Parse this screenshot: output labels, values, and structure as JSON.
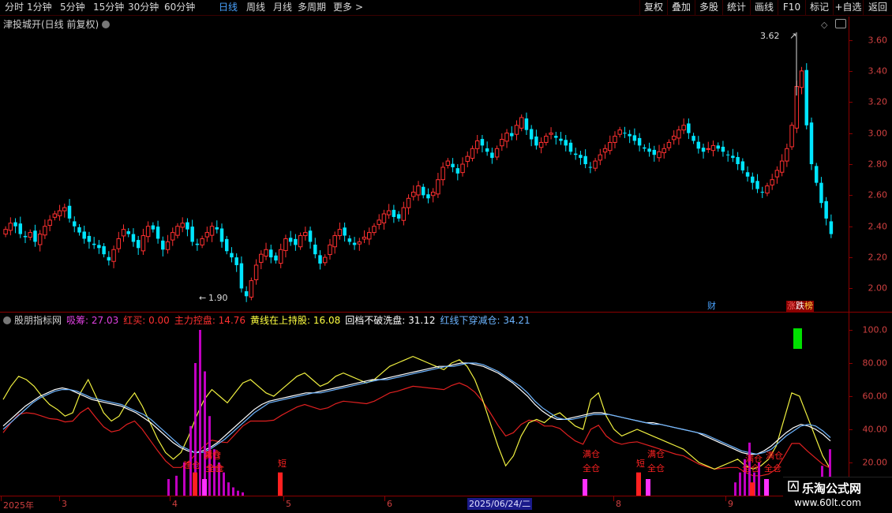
{
  "toolbar": {
    "periods": [
      "分时",
      "1分钟",
      "5分钟",
      "15分钟",
      "30分钟",
      "60分钟",
      "日线",
      "周线",
      "月线",
      "多周期",
      "更多"
    ],
    "active_period": "日线",
    "more_arrow": ">",
    "right_buttons": [
      "复权",
      "叠加",
      "多股",
      "统计",
      "画线",
      "F10",
      "标记",
      "+自选",
      "返回"
    ]
  },
  "main": {
    "title": "津投城开(日线 前复权)",
    "high_label": "3.62",
    "low_label": "1.90",
    "cai_badge": "财",
    "zdb_badge": [
      "涨",
      "跌",
      "榜"
    ],
    "y_ticks": [
      "3.60",
      "3.40",
      "3.20",
      "3.00",
      "2.80",
      "2.60",
      "2.40",
      "2.20",
      "2.00"
    ]
  },
  "indicator": {
    "name": "股朋指标网",
    "legend": [
      {
        "label": "吸筹: 27.03",
        "color": "#e040e0"
      },
      {
        "label": "红买: 0.00",
        "color": "#ff3030"
      },
      {
        "label": "主力控盘: 14.76",
        "color": "#ff3030"
      },
      {
        "label": "黄线在上持股: 16.08",
        "color": "#ffff40"
      },
      {
        "label": "回档不破洗盘: 31.12",
        "color": "#ffffff"
      },
      {
        "label": "红线下穿减仓: 34.21",
        "color": "#6cb4ff"
      }
    ],
    "y_ticks": [
      "100.0",
      "80.00",
      "60.00",
      "40.00",
      "20.00"
    ],
    "signals": [
      "建仓",
      "满仓",
      "全仓",
      "减仓",
      "全仓",
      "短",
      "满仓",
      "全仓",
      "短",
      "满仓",
      "全仓",
      "满仓",
      "全仓",
      "满仓",
      "全仓"
    ]
  },
  "date_axis": {
    "labels": [
      "2025年",
      "3",
      "4",
      "5",
      "6",
      "8",
      "9"
    ],
    "selected": "2025/06/24/二"
  },
  "watermark": {
    "name": "乐淘公式网",
    "url": "www.60lt.com"
  },
  "colors": {
    "up": "#ff3030",
    "down": "#00e5ff",
    "axis": "#8b0000"
  },
  "chart_data": {
    "type": "candlestick",
    "ylim": [
      1.85,
      3.75
    ],
    "closes": [
      2.38,
      2.42,
      2.4,
      2.35,
      2.33,
      2.36,
      2.3,
      2.35,
      2.4,
      2.44,
      2.48,
      2.5,
      2.52,
      2.45,
      2.4,
      2.36,
      2.32,
      2.3,
      2.28,
      2.26,
      2.22,
      2.18,
      2.25,
      2.32,
      2.38,
      2.35,
      2.3,
      2.26,
      2.34,
      2.4,
      2.38,
      2.32,
      2.25,
      2.3,
      2.36,
      2.4,
      2.42,
      2.38,
      2.3,
      2.28,
      2.32,
      2.36,
      2.4,
      2.38,
      2.3,
      2.24,
      2.2,
      2.15,
      2.0,
      1.95,
      2.05,
      2.15,
      2.22,
      2.25,
      2.2,
      2.18,
      2.25,
      2.32,
      2.3,
      2.28,
      2.34,
      2.36,
      2.3,
      2.22,
      2.16,
      2.2,
      2.28,
      2.34,
      2.38,
      2.34,
      2.3,
      2.28,
      2.3,
      2.33,
      2.36,
      2.4,
      2.44,
      2.48,
      2.5,
      2.46,
      2.45,
      2.52,
      2.58,
      2.62,
      2.66,
      2.6,
      2.58,
      2.62,
      2.7,
      2.78,
      2.82,
      2.78,
      2.74,
      2.8,
      2.85,
      2.9,
      2.95,
      2.92,
      2.88,
      2.84,
      2.9,
      2.96,
      3.0,
      2.98,
      3.05,
      3.1,
      3.02,
      2.96,
      2.92,
      2.94,
      2.98,
      3.0,
      2.97,
      2.95,
      2.92,
      2.88,
      2.86,
      2.84,
      2.8,
      2.78,
      2.82,
      2.86,
      2.9,
      2.94,
      2.98,
      3.02,
      3.0,
      2.98,
      2.95,
      2.92,
      2.9,
      2.88,
      2.86,
      2.88,
      2.9,
      2.94,
      2.98,
      3.02,
      3.05,
      3.0,
      2.95,
      2.9,
      2.88,
      2.9,
      2.92,
      2.9,
      2.88,
      2.86,
      2.84,
      2.8,
      2.76,
      2.72,
      2.68,
      2.64,
      2.62,
      2.66,
      2.7,
      2.76,
      2.82,
      2.9,
      3.05,
      3.3,
      3.4,
      3.05,
      2.8,
      2.68,
      2.55,
      2.45,
      2.35
    ],
    "ind_series": {
      "white": [
        42,
        46,
        50,
        54,
        57,
        60,
        62,
        64,
        65,
        64,
        62,
        60,
        58,
        57,
        56,
        55,
        54,
        52,
        50,
        47,
        44,
        40,
        36,
        32,
        29,
        27,
        26,
        27,
        29,
        32,
        36,
        40,
        44,
        48,
        52,
        55,
        57,
        58,
        59,
        60,
        61,
        62,
        62,
        63,
        64,
        65,
        66,
        67,
        68,
        69,
        70,
        70,
        71,
        72,
        73,
        74,
        75,
        76,
        77,
        78,
        78,
        79,
        80,
        80,
        79,
        78,
        76,
        74,
        71,
        68,
        64,
        60,
        55,
        51,
        48,
        46,
        46,
        47,
        48,
        49,
        50,
        50,
        49,
        48,
        47,
        46,
        45,
        44,
        44,
        43,
        42,
        41,
        40,
        39,
        38,
        36,
        34,
        32,
        30,
        28,
        26,
        25,
        25,
        27,
        30,
        34,
        38,
        41,
        43,
        42,
        40,
        37,
        33
      ],
      "blue": [
        40,
        44,
        48,
        52,
        56,
        59,
        61,
        63,
        64,
        64,
        63,
        61,
        59,
        58,
        57,
        56,
        55,
        53,
        51,
        49,
        46,
        42,
        38,
        34,
        30,
        28,
        26,
        26,
        28,
        31,
        34,
        38,
        42,
        46,
        50,
        53,
        56,
        57,
        58,
        59,
        60,
        61,
        62,
        62,
        63,
        64,
        65,
        66,
        67,
        68,
        69,
        70,
        70,
        71,
        72,
        73,
        74,
        75,
        76,
        77,
        78,
        78,
        79,
        80,
        80,
        79,
        77,
        75,
        72,
        69,
        66,
        62,
        57,
        53,
        50,
        47,
        46,
        46,
        47,
        48,
        49,
        49,
        49,
        48,
        47,
        46,
        45,
        44,
        43,
        43,
        42,
        41,
        40,
        39,
        38,
        37,
        35,
        33,
        31,
        29,
        27,
        26,
        25,
        26,
        28,
        32,
        36,
        39,
        42,
        43,
        42,
        39,
        35
      ],
      "yellow": [
        58,
        66,
        72,
        70,
        66,
        60,
        55,
        52,
        48,
        50,
        62,
        70,
        60,
        50,
        45,
        48,
        56,
        62,
        54,
        44,
        34,
        26,
        22,
        26,
        36,
        48,
        58,
        64,
        60,
        56,
        62,
        68,
        70,
        66,
        62,
        60,
        64,
        68,
        72,
        74,
        70,
        66,
        68,
        72,
        74,
        72,
        70,
        68,
        70,
        74,
        78,
        80,
        82,
        84,
        82,
        80,
        78,
        76,
        80,
        82,
        78,
        70,
        58,
        44,
        30,
        18,
        24,
        36,
        44,
        46,
        44,
        48,
        50,
        46,
        42,
        40,
        58,
        62,
        48,
        40,
        36,
        38,
        40,
        38,
        36,
        34,
        32,
        30,
        28,
        24,
        20,
        18,
        16,
        18,
        20,
        22,
        18,
        16,
        18,
        22,
        30,
        46,
        62,
        60,
        48,
        36,
        24,
        16
      ]
    }
  }
}
